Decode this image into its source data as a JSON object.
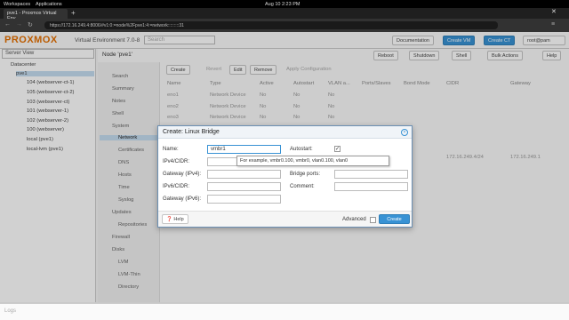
{
  "gnome": {
    "workspaces": "Workspaces",
    "applications": "Applications",
    "clock": "Aug 10  2:23 PM"
  },
  "browser": {
    "tab_title": "pve1 - Proxmox Virtual Env",
    "url": "https://172.16.249.4:8006/#v1:0:=node%2Fpve1:4:=network:::::::::31",
    "new_tab": "+"
  },
  "header": {
    "logo": "PROXMOX",
    "product": "Virtual Environment 7.0-8",
    "search_placeholder": "Search",
    "documentation": "Documentation",
    "create_vm": "Create VM",
    "create_ct": "Create CT",
    "user": "root@pam"
  },
  "sidebar": {
    "view": "Server View",
    "items": [
      "Datacenter",
      "pve1",
      "104 (webserver-ct-1)",
      "105 (webserver-ct-2)",
      "103 (webserver-ct)",
      "101 (webserver-1)",
      "102 (webserver-2)",
      "100 (webserver)",
      "local (pve1)",
      "local-lvm (pve1)"
    ]
  },
  "node": {
    "title": "Node 'pve1'",
    "reboot": "Reboot",
    "shutdown": "Shutdown",
    "shell": "Shell",
    "bulk": "Bulk Actions",
    "help": "Help"
  },
  "menu": [
    "Search",
    "Summary",
    "Notes",
    "Shell",
    "System",
    "Network",
    "Certificates",
    "DNS",
    "Hosts",
    "Time",
    "Syslog",
    "Updates",
    "Repositories",
    "Firewall",
    "Disks",
    "LVM",
    "LVM-Thin",
    "Directory"
  ],
  "toolbar": {
    "create": "Create",
    "revert": "Revert",
    "edit": "Edit",
    "remove": "Remove",
    "apply": "Apply Configuration"
  },
  "table": {
    "headers": [
      "Name",
      "Type",
      "Active",
      "Autostart",
      "VLAN a...",
      "Ports/Slaves",
      "Bond Mode",
      "CIDR",
      "Gateway"
    ],
    "rows": [
      [
        "eno1",
        "Network Device",
        "No",
        "No",
        "No"
      ],
      [
        "eno2",
        "Network Device",
        "No",
        "No",
        "No"
      ],
      [
        "eno3",
        "Network Device",
        "No",
        "No",
        "No"
      ]
    ],
    "bridge_cidr": "172.16.249.4/24",
    "bridge_gateway": "172.16.249.1"
  },
  "dialog": {
    "title": "Create: Linux Bridge",
    "name_label": "Name:",
    "name_value": "vmbr1",
    "ipv4_label": "IPv4/CIDR:",
    "gw4_label": "Gateway (IPv4):",
    "ipv6_label": "IPv6/CIDR:",
    "gw6_label": "Gateway (IPv6):",
    "autostart_label": "Autostart:",
    "bridge_ports_label": "Bridge ports:",
    "comment_label": "Comment:",
    "help": "Help",
    "advanced": "Advanced",
    "create": "Create"
  },
  "tooltip": "For example, vmbr0.100, vmbr0, vlan0.100, vlan0",
  "log": "Logs"
}
